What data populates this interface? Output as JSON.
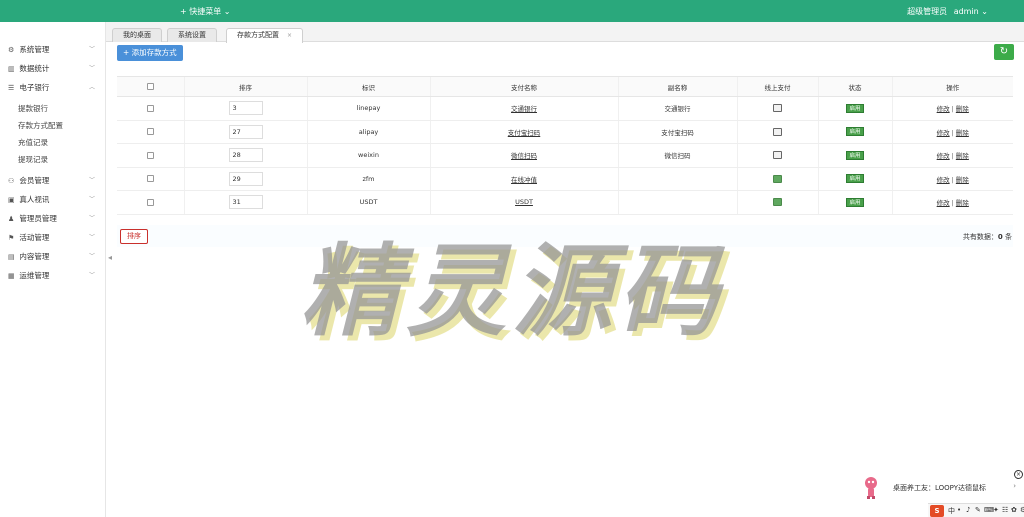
{
  "topbar": {
    "quick_menu": "+ 快捷菜单 ⌄",
    "role": "超级管理员",
    "username": "admin ⌄"
  },
  "sidebar": {
    "items": [
      {
        "icon": "gear-icon",
        "glyph": "⚙",
        "label": "系统管理",
        "expanded": false
      },
      {
        "icon": "stats-icon",
        "glyph": "▥",
        "label": "数据统计",
        "expanded": false
      },
      {
        "icon": "bank-icon",
        "glyph": "☰",
        "label": "电子银行",
        "expanded": true,
        "children": [
          "提款银行",
          "存款方式配置",
          "充值记录",
          "提现记录"
        ]
      },
      {
        "icon": "member-icon",
        "glyph": "⚇",
        "label": "会员管理",
        "expanded": false
      },
      {
        "icon": "live-icon",
        "glyph": "▣",
        "label": "真人视讯",
        "expanded": false
      },
      {
        "icon": "admin-icon",
        "glyph": "♟",
        "label": "管理员管理",
        "expanded": false
      },
      {
        "icon": "activity-icon",
        "glyph": "⚑",
        "label": "活动管理",
        "expanded": false
      },
      {
        "icon": "content-icon",
        "glyph": "▤",
        "label": "内容管理",
        "expanded": false
      },
      {
        "icon": "ops-icon",
        "glyph": "▦",
        "label": "运维管理",
        "expanded": false
      }
    ]
  },
  "tabs": [
    {
      "label": "我的桌面",
      "active": false
    },
    {
      "label": "系统设置",
      "active": false
    },
    {
      "label": "存款方式配置",
      "active": true,
      "close": "×"
    }
  ],
  "toolbar": {
    "add_label": "+ 添加存款方式",
    "refresh_glyph": "↻"
  },
  "table": {
    "headers": [
      "排序",
      "标识",
      "支付名称",
      "副名称",
      "线上支付",
      "状态",
      "操作"
    ],
    "rows": [
      {
        "sort": "3",
        "code": "linepay",
        "name": "交通银行",
        "subname": "交通银行",
        "online": false,
        "status": "启用"
      },
      {
        "sort": "27",
        "code": "alipay",
        "name": "支付宝扫码",
        "subname": "支付宝扫码",
        "online": false,
        "status": "启用"
      },
      {
        "sort": "28",
        "code": "weixin",
        "name": "微信扫码",
        "subname": "微信扫码",
        "online": false,
        "status": "启用"
      },
      {
        "sort": "29",
        "code": "zfm",
        "name": "在线冲值",
        "subname": "",
        "online": true,
        "status": "启用"
      },
      {
        "sort": "31",
        "code": "USDT",
        "name": "USDT",
        "subname": "",
        "online": true,
        "status": "启用"
      }
    ],
    "ops": {
      "edit": "修改",
      "sep": "|",
      "delete": "删除"
    }
  },
  "footer": {
    "sort_button": "排序",
    "total_prefix": "共有数据：",
    "total_count": "0",
    "total_suffix": " 条"
  },
  "watermark": "精灵源码",
  "ime": {
    "tip": "桌面养工友：LOOPY达德鼠标",
    "more": "›",
    "logo": "S",
    "icons": [
      "中",
      "•",
      "♪",
      "✎",
      "⌨",
      "✦",
      "☷",
      "✿",
      "⚙"
    ]
  },
  "colors": {
    "topbar": "#2aa87c",
    "primary": "#4a90d9",
    "success": "#3cab49",
    "danger": "#c9302c"
  }
}
